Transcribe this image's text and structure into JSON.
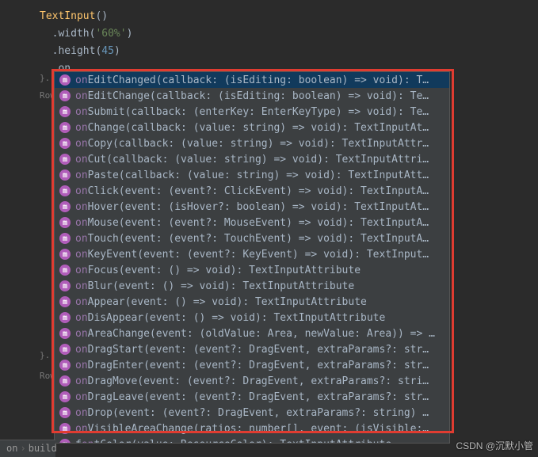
{
  "code": {
    "line1_class": "TextInput",
    "line1_paren": "()",
    "line2_method": ".width",
    "line2_open": "(",
    "line2_arg": "'60%'",
    "line2_close": ")",
    "line3_method": ".height",
    "line3_open": "(",
    "line3_arg": "45",
    "line3_close": ")",
    "line4_method": ".on"
  },
  "faded": {
    "brace": "}.",
    "row": "Row"
  },
  "breadcrumb": {
    "seg1": "on",
    "seg2": "build"
  },
  "popup": {
    "items": [
      {
        "prefix": "on",
        "rest": "EditChanged(callback: (isEditing: boolean) => void): T…",
        "sel": true
      },
      {
        "prefix": "on",
        "rest": "EditChange(callback: (isEditing: boolean) => void): Te…"
      },
      {
        "prefix": "on",
        "rest": "Submit(callback: (enterKey: EnterKeyType) => void): Te…"
      },
      {
        "prefix": "on",
        "rest": "Change(callback: (value: string) => void): TextInputAt…"
      },
      {
        "prefix": "on",
        "rest": "Copy(callback: (value: string) => void): TextInputAttr…"
      },
      {
        "prefix": "on",
        "rest": "Cut(callback: (value: string) => void): TextInputAttri…"
      },
      {
        "prefix": "on",
        "rest": "Paste(callback: (value: string) => void): TextInputAtt…"
      },
      {
        "prefix": "on",
        "rest": "Click(event: (event?: ClickEvent) => void): TextInputA…"
      },
      {
        "prefix": "on",
        "rest": "Hover(event: (isHover?: boolean) => void): TextInputAt…"
      },
      {
        "prefix": "on",
        "rest": "Mouse(event: (event?: MouseEvent) => void): TextInputA…"
      },
      {
        "prefix": "on",
        "rest": "Touch(event: (event?: TouchEvent) => void): TextInputA…"
      },
      {
        "prefix": "on",
        "rest": "KeyEvent(event: (event?: KeyEvent) => void): TextInput…"
      },
      {
        "prefix": "on",
        "rest": "Focus(event: () => void): TextInputAttribute"
      },
      {
        "prefix": "on",
        "rest": "Blur(event: () => void): TextInputAttribute"
      },
      {
        "prefix": "on",
        "rest": "Appear(event: () => void): TextInputAttribute"
      },
      {
        "prefix": "on",
        "rest": "DisAppear(event: () => void): TextInputAttribute"
      },
      {
        "prefix": "on",
        "rest": "AreaChange(event: (oldValue: Area, newValue: Area)) => …"
      },
      {
        "prefix": "on",
        "rest": "DragStart(event: (event?: DragEvent, extraParams?: str…"
      },
      {
        "prefix": "on",
        "rest": "DragEnter(event: (event?: DragEvent, extraParams?: str…"
      },
      {
        "prefix": "on",
        "rest": "DragMove(event: (event?: DragEvent, extraParams?: stri…"
      },
      {
        "prefix": "on",
        "rest": "DragLeave(event: (event?: DragEvent, extraParams?: str…"
      },
      {
        "prefix": "on",
        "rest": "Drop(event: (event?: DragEvent, extraParams?: string) …"
      },
      {
        "prefix": "on",
        "rest": "VisibleAreaChange(ratios: number[], event: (isVisible:…"
      },
      {
        "prefix": "f",
        "match2": "on",
        "rest": "tColor(value: ResourceColor): TextInputAttribute"
      }
    ]
  },
  "watermark": "CSDN @沉默小管"
}
